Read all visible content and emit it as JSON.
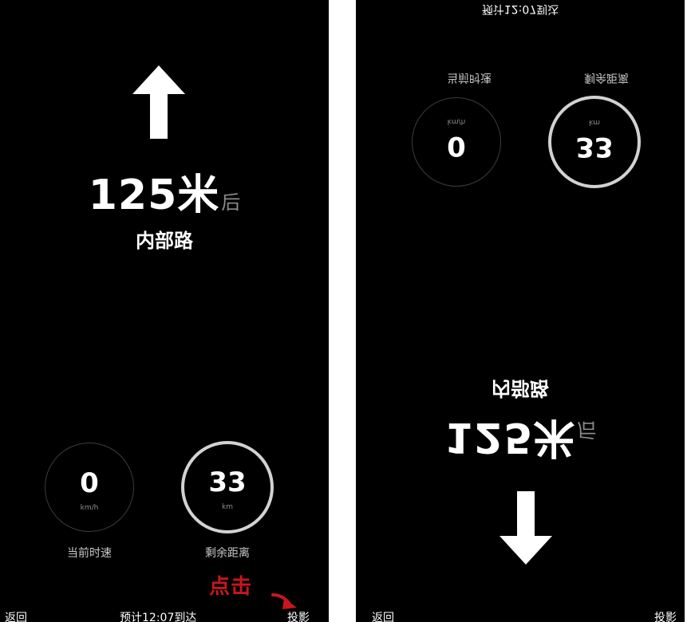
{
  "nav": {
    "distance_value": "125米",
    "distance_suffix": "后",
    "road_name": "内部路",
    "turn_icon": "arrow-straight-icon"
  },
  "speed": {
    "value": "0",
    "unit": "km/h",
    "label": "当前时速"
  },
  "remaining": {
    "value": "33",
    "unit": "km",
    "label": "剩余距离"
  },
  "bottom_bar": {
    "back_label": "返回",
    "eta_text": "预计12:07到达",
    "projection_label": "投影"
  },
  "annotation": {
    "click_hint": "点击",
    "color": "#c8161d"
  },
  "colors": {
    "background": "#000000",
    "text": "#ffffff",
    "dim_text": "#8a8a8a",
    "ring": "#d2d2d2"
  }
}
